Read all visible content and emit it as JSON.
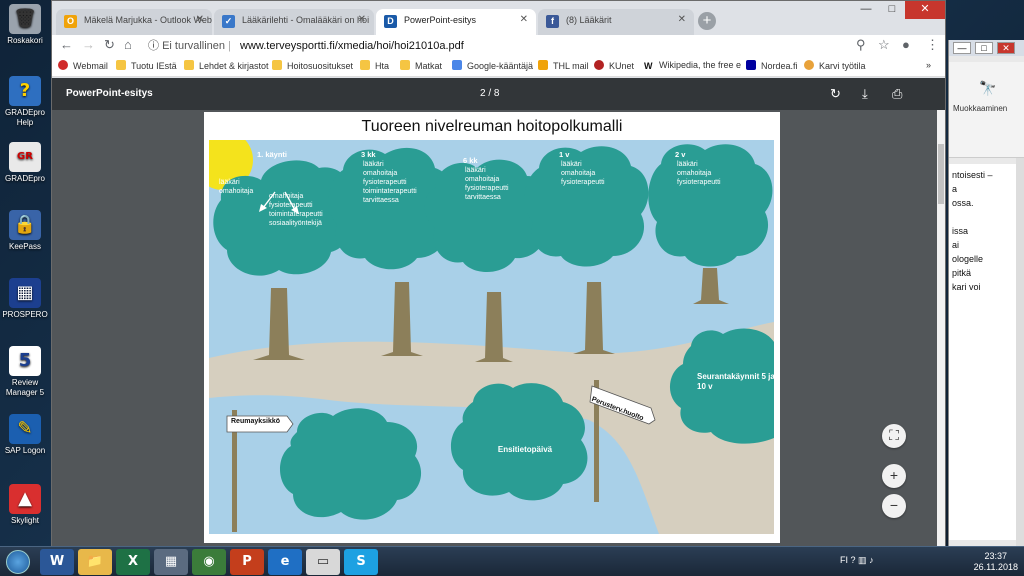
{
  "desktop_icons": [
    {
      "label": "Roskakori",
      "icon": "recycle-bin-icon"
    },
    {
      "label": "GRADEpro Help",
      "icon": "help-icon"
    },
    {
      "label": "GRADEpro",
      "icon": "gradepro-icon"
    },
    {
      "label": "KeePass",
      "icon": "lock-icon"
    },
    {
      "label": "PROSPERO",
      "icon": "grid-icon"
    },
    {
      "label": "Review Manager 5",
      "icon": "review-manager-icon"
    },
    {
      "label": "SAP Logon",
      "icon": "sap-icon"
    },
    {
      "label": "Skylight",
      "icon": "skylight-icon"
    }
  ],
  "browser": {
    "tabs": [
      {
        "title": "Mäkelä Marjukka - Outlook Web",
        "icon": "outlook-icon",
        "color": "#f0a30a"
      },
      {
        "title": "Lääkärilehti - Omalääkäri on hoi",
        "icon": "laakarilehti-icon",
        "color": "#3a78c9"
      },
      {
        "title": "PowerPoint-esitys",
        "icon": "duodecim-icon",
        "color": "#1a5aa8"
      },
      {
        "title": "(8) Lääkärit",
        "icon": "facebook-icon",
        "color": "#3b5998"
      }
    ],
    "address": {
      "security": "Ei turvallinen",
      "url": "www.terveysportti.fi/xmedia/hoi/hoi21010a.pdf"
    },
    "bookmarks": [
      "Webmail",
      "Tuotu IEstä",
      "Lehdet & kirjastot",
      "Hoitosuositukset",
      "Hta",
      "Matkat",
      "Google-kääntäjä",
      "THL mail",
      "KUnet",
      "Wikipedia, the free e",
      "Nordea.fi",
      "Karvi työtila"
    ]
  },
  "pdf": {
    "title": "PowerPoint-esitys",
    "page": "2 / 8",
    "slide": {
      "title": "Tuoreen nivelreuman hoitopolkumalli",
      "trees": [
        {
          "heading": "1. käynti",
          "items_a": [
            "lääkäri",
            "omahoitaja"
          ],
          "items_b": [
            "omahoitaja",
            "fysioterapeutti",
            "toimintaterapeutti",
            "sosiaalityöntekijä"
          ]
        },
        {
          "heading": "3 kk",
          "items": [
            "lääkäri",
            "omahoitaja",
            "fysioterapeutti",
            "toimintaterapeutti",
            "tarvittaessa"
          ]
        },
        {
          "heading": "6 kk",
          "items": [
            "lääkäri",
            "omahoitaja",
            "fysioterapeutti",
            "tarvittaessa"
          ]
        },
        {
          "heading": "1 v",
          "items": [
            "lääkäri",
            "omahoitaja",
            "fysioterapeutti"
          ]
        },
        {
          "heading": "2 v",
          "items": [
            "lääkäri",
            "omahoitaja",
            "fysioterapeutti"
          ]
        }
      ],
      "signs": {
        "left": "Reumayksikkö",
        "right": "Perusterv.huolto"
      },
      "bushes": {
        "center": "Ensitietopäivä",
        "right": "Seurantakäynnit 5 ja 10 v"
      }
    }
  },
  "word": {
    "ribbon_label": "Muokkaaminen",
    "lines": [
      "ntoisesti –",
      "",
      "a",
      "ossa.",
      "",
      "issa",
      "ai",
      "ologelle",
      "pitkä",
      "kari voi"
    ]
  },
  "taskbar": {
    "apps": [
      "W",
      "📁",
      "X",
      "▦",
      "◉",
      "P",
      "e",
      "▭",
      "S"
    ],
    "lang": "FI",
    "time": "23:37",
    "date": "26.11.2018"
  },
  "colors": {
    "tree": "#2a9d94",
    "sky": "#a9d0e8",
    "path": "#d6cfbf",
    "sun": "#f4e31c"
  }
}
